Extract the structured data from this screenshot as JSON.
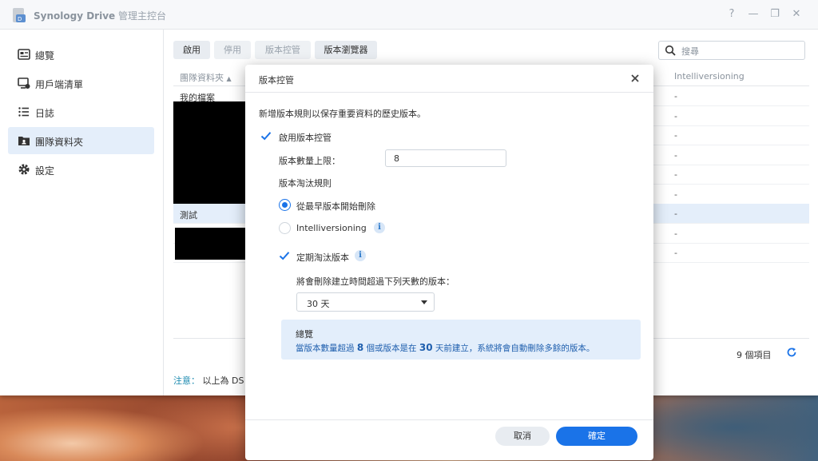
{
  "window": {
    "title_brand": "Synology Drive",
    "title_suffix": "管理主控台",
    "controls": {
      "help": "?",
      "minimize": "—",
      "maximize": "❐",
      "close": "✕"
    }
  },
  "sidebar": {
    "items": [
      {
        "label": "總覽",
        "icon": "overview-icon"
      },
      {
        "label": "用戶端清單",
        "icon": "client-list-icon"
      },
      {
        "label": "日誌",
        "icon": "log-icon"
      },
      {
        "label": "團隊資料夾",
        "icon": "team-folder-icon",
        "active": true
      },
      {
        "label": "設定",
        "icon": "gear-icon"
      }
    ]
  },
  "toolbar": {
    "enable": "啟用",
    "disable": "停用",
    "version_control": "版本控管",
    "version_browser": "版本瀏覽器",
    "search_placeholder": "搜尋"
  },
  "table": {
    "col_name": "團隊資料夾",
    "col_intelliversioning": "Intelliversioning",
    "rows": [
      {
        "name": "我的檔案",
        "iv": "-"
      },
      {
        "name": "",
        "iv": "-"
      },
      {
        "name": "",
        "iv": "-"
      },
      {
        "name": "",
        "iv": "-"
      },
      {
        "name": "",
        "iv": "-"
      },
      {
        "name": "",
        "iv": "-"
      },
      {
        "name": "測試",
        "iv": "-",
        "selected": true
      },
      {
        "name": "",
        "iv": "-"
      },
      {
        "name": "",
        "iv": "-"
      }
    ],
    "item_count": "9 個項目"
  },
  "note": {
    "label": "注意：",
    "text": "以上為 DS"
  },
  "dialog": {
    "title": "版本控管",
    "description": "新增版本規則以保存重要資料的歷史版本。",
    "enable_label": "啟用版本控管",
    "enable_checked": true,
    "max_versions_label": "版本數量上限：",
    "max_versions_value": "8",
    "rotation_label": "版本淘汰規則",
    "rotation_oldest": "從最早版本開始刪除",
    "rotation_intelliversioning": "Intelliversioning",
    "rotation_selected": "oldest",
    "periodic_label": "定期淘汰版本",
    "periodic_checked": true,
    "periodic_desc": "將會刪除建立時間超過下列天數的版本：",
    "days_value": "30 天",
    "summary_title": "總覽",
    "summary_prefix": "當版本數量超過",
    "summary_count": "8",
    "summary_mid": "個或版本是在",
    "summary_days": "30",
    "summary_suffix": "天前建立，系統將會自動刪除多餘的版本。",
    "cancel": "取消",
    "ok": "確定"
  },
  "colors": {
    "accent": "#1a73e8",
    "selected_row": "#e4eefa",
    "summary_bg": "#e3eefb"
  }
}
